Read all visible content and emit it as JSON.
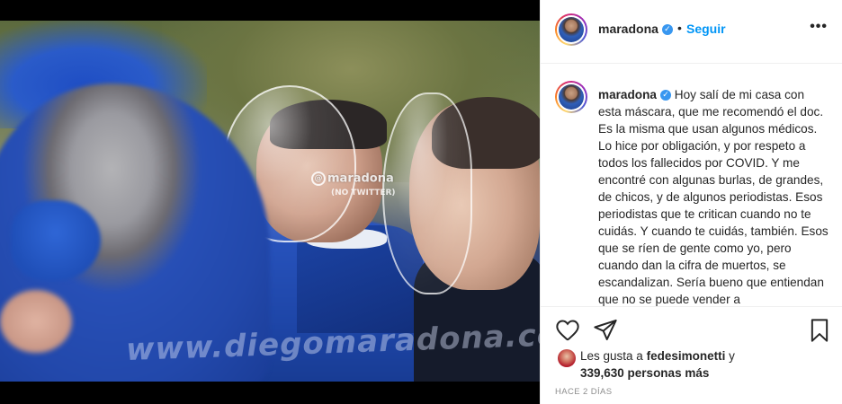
{
  "post": {
    "username": "maradona",
    "verified_badge": "✓",
    "separator": "•",
    "follow_label": "Seguir",
    "more_label": "•••",
    "watermark_handle": "maradona",
    "watermark_handle_at": "@",
    "watermark_note": "(NO TWITTER)",
    "watermark_site": "www.diegomaradona.com"
  },
  "caption": {
    "username": "maradona",
    "text": "Hoy salí de mi casa con esta máscara, que me recomendó el doc. Es la misma que usan algunos médicos. Lo hice por obligación, y por respeto a todos los fallecidos por COVID. Y me encontré con algunas burlas, de grandes, de chicos, y de algunos periodistas. Esos periodistas que te critican cuando no te cuidás. Y cuando te cuidás, también. Esos que se ríen de gente como yo, pero cuando dan la cifra de muertos, se escandalizan. Sería bueno que entiendan que no se puede vender a"
  },
  "actions": {
    "like_icon": "heart-icon",
    "share_icon": "paper-plane-icon",
    "save_icon": "bookmark-icon"
  },
  "likes": {
    "prefix": "Les gusta a",
    "user": "fedesimonetti",
    "connector": "y",
    "count_text": "339,630 personas más"
  },
  "timestamp": "HACE 2 DÍAS",
  "colors": {
    "link_blue": "#0095f6",
    "verified_blue": "#3897f0",
    "muted": "#8e8e8e",
    "border": "#efefef"
  }
}
